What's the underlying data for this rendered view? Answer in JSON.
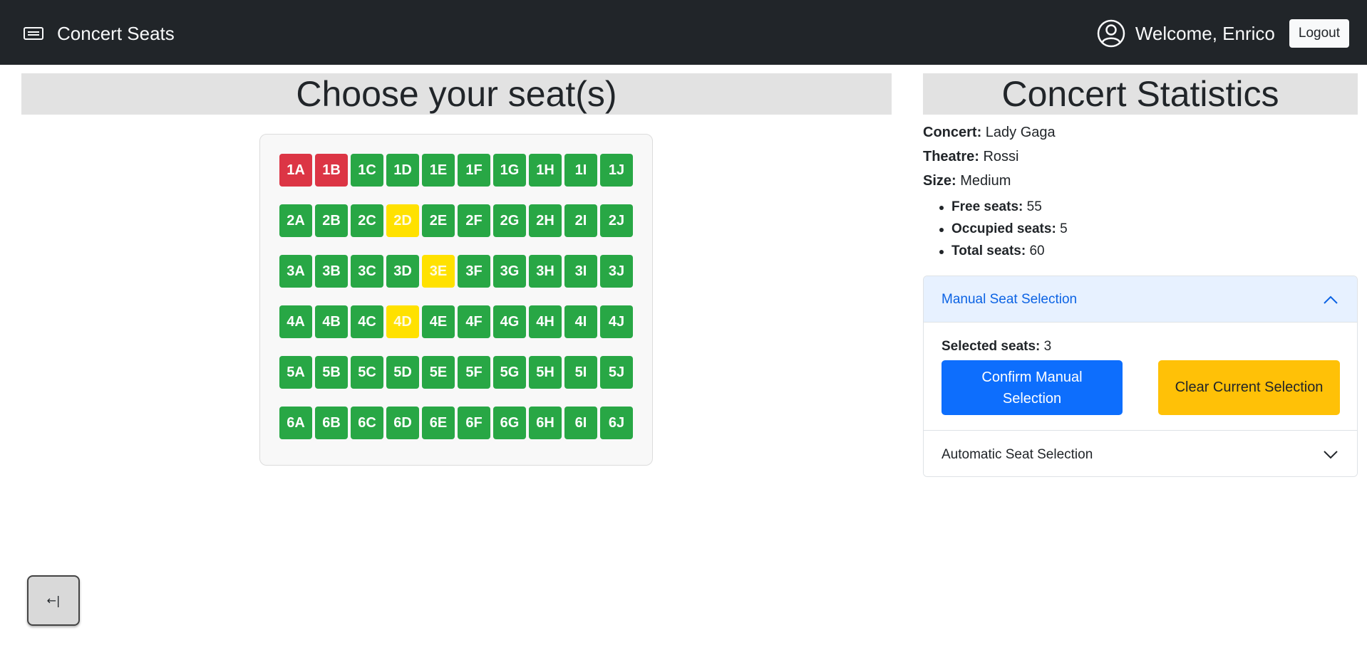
{
  "navbar": {
    "brand": "Concert Seats",
    "brand_icon": "ticket-icon",
    "user_icon": "user-circle-icon",
    "welcome": "Welcome, Enrico",
    "logout_label": "Logout"
  },
  "left": {
    "title": "Choose your seat(s)"
  },
  "seats": {
    "rows": [
      "1",
      "2",
      "3",
      "4",
      "5",
      "6"
    ],
    "columns": [
      "A",
      "B",
      "C",
      "D",
      "E",
      "F",
      "G",
      "H",
      "I",
      "J"
    ],
    "occupied": [
      "1A",
      "1B"
    ],
    "selected": [
      "2D",
      "3E",
      "4D"
    ],
    "colors": {
      "free": "#28a745",
      "occupied": "#dc3545",
      "selected": "#ffe100"
    }
  },
  "stats": {
    "title": "Concert Statistics",
    "concert_label": "Concert:",
    "concert": "Lady Gaga",
    "theatre_label": "Theatre:",
    "theatre": "Rossi",
    "size_label": "Size:",
    "size": "Medium",
    "free_label": "Free seats:",
    "free": "55",
    "occupied_label": "Occupied seats:",
    "occupied": "5",
    "total_label": "Total seats:",
    "total": "60"
  },
  "accordion": {
    "manual_header": "Manual Seat Selection",
    "manual_expanded": true,
    "selected_label": "Selected seats:",
    "selected_count": "3",
    "confirm_label": "Confirm Manual Selection",
    "clear_label": "Clear Current Selection",
    "automatic_header": "Automatic Seat Selection",
    "automatic_expanded": false
  },
  "sidebar_toggle": {
    "label": "←|",
    "icon": "collapse-left-icon"
  }
}
